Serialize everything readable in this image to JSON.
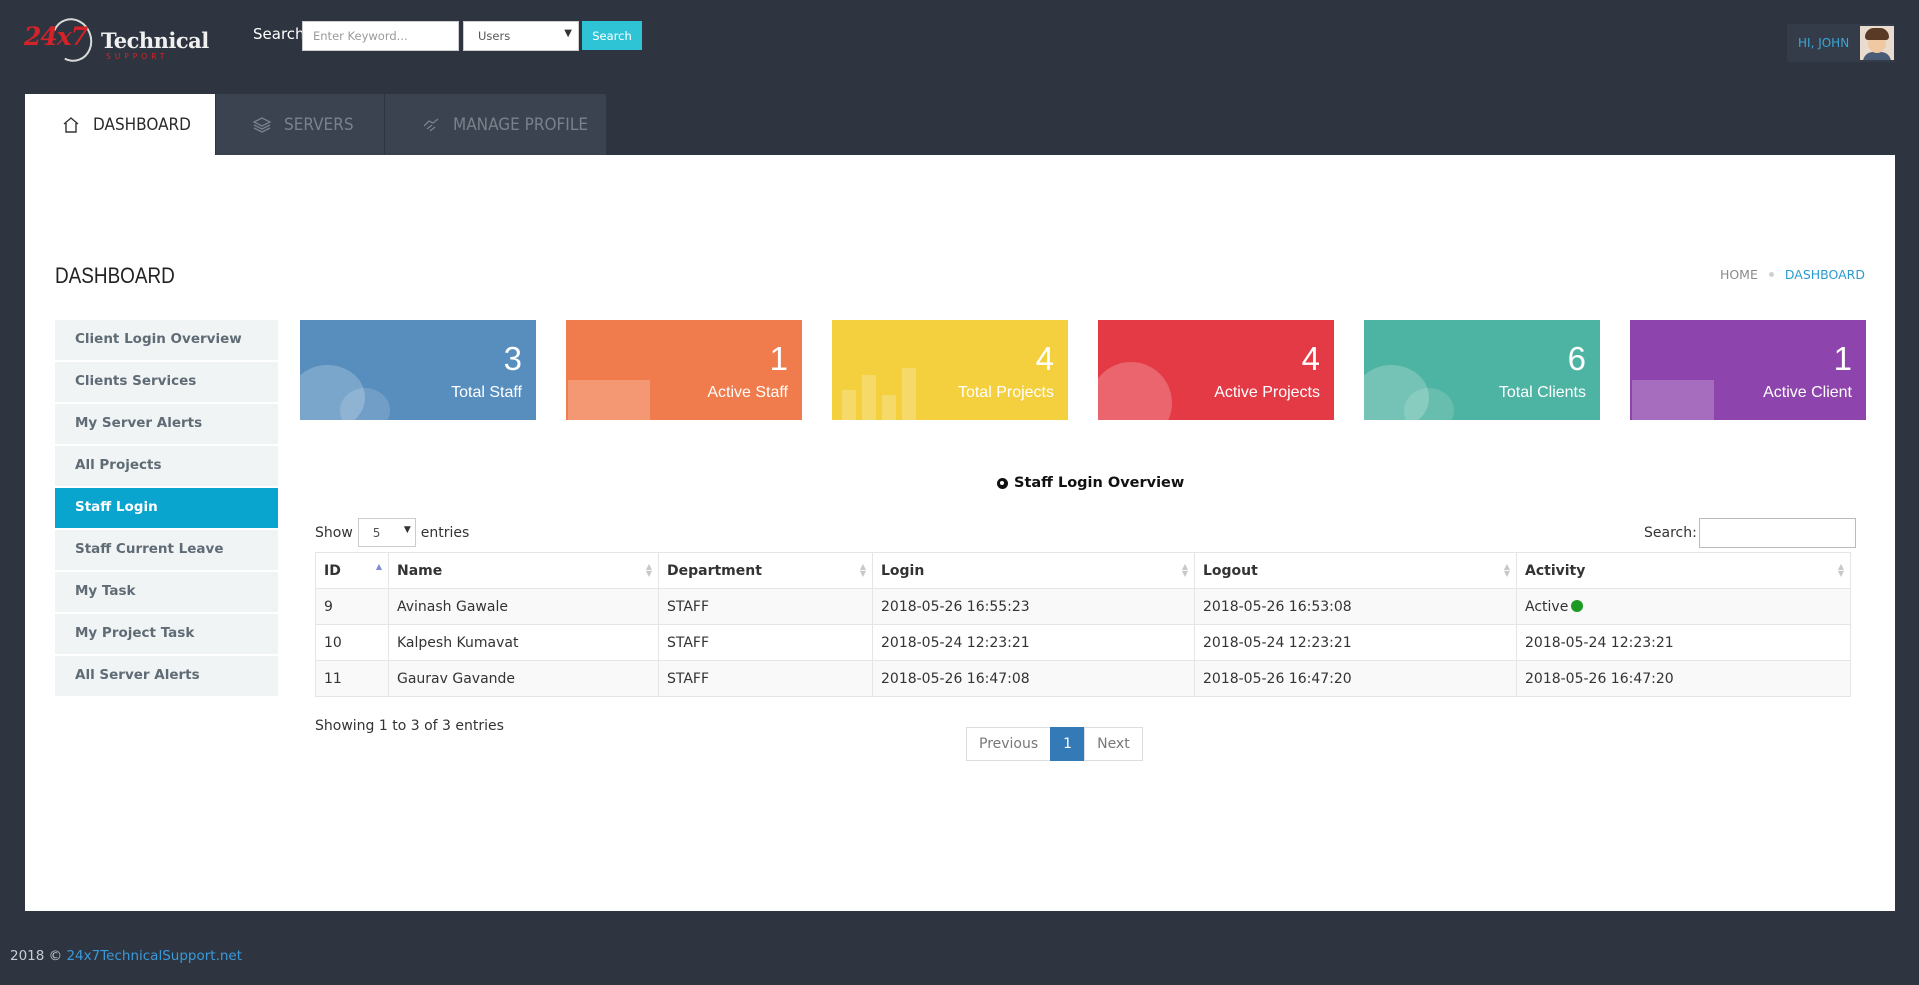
{
  "brand": {
    "logo_number": "24x7",
    "logo_name": "Technical",
    "logo_sub": "SUPPORT"
  },
  "header": {
    "search_label": "Search",
    "search_placeholder": "Enter Keyword...",
    "search_category": "Users",
    "search_button": "Search",
    "greeting": "HI, JOHN"
  },
  "tabs": [
    {
      "label": "DASHBOARD",
      "icon": "home-icon",
      "active": true
    },
    {
      "label": "SERVERS",
      "icon": "layers-icon",
      "active": false
    },
    {
      "label": "MANAGE PROFILE",
      "icon": "hand-icon",
      "active": false
    }
  ],
  "page": {
    "title": "DASHBOARD",
    "breadcrumb": [
      "HOME",
      "DASHBOARD"
    ]
  },
  "sidebar": {
    "items": [
      {
        "label": "Client Login Overview",
        "active": false
      },
      {
        "label": "Clients Services",
        "active": false
      },
      {
        "label": "My Server Alerts",
        "active": false
      },
      {
        "label": "All Projects",
        "active": false
      },
      {
        "label": "Staff Login",
        "active": true
      },
      {
        "label": "Staff Current Leave",
        "active": false
      },
      {
        "label": "My Task",
        "active": false
      },
      {
        "label": "My Project Task",
        "active": false
      },
      {
        "label": "All Server Alerts",
        "active": false
      }
    ]
  },
  "stats": [
    {
      "value": "3",
      "label": "Total Staff",
      "color": "#578ebe"
    },
    {
      "value": "1",
      "label": "Active Staff",
      "color": "#f07b4c"
    },
    {
      "value": "4",
      "label": "Total Projects",
      "color": "#f4d03f"
    },
    {
      "value": "4",
      "label": "Active Projects",
      "color": "#e43a45"
    },
    {
      "value": "6",
      "label": "Total Clients",
      "color": "#4db3a2"
    },
    {
      "value": "1",
      "label": "Active Client",
      "color": "#8e44ad"
    }
  ],
  "table": {
    "title": "Staff Login Overview",
    "show_label": "Show",
    "show_value": "5",
    "entries_label": "entries",
    "search_label": "Search:",
    "columns": [
      "ID",
      "Name",
      "Department",
      "Login",
      "Logout",
      "Activity"
    ],
    "rows": [
      {
        "id": "9",
        "name": "Avinash Gawale",
        "department": "STAFF",
        "login": "2018-05-26 16:55:23",
        "logout": "2018-05-26 16:53:08",
        "activity": "Active"
      },
      {
        "id": "10",
        "name": "Kalpesh Kumavat",
        "department": "STAFF",
        "login": "2018-05-24 12:23:21",
        "logout": "2018-05-24 12:23:21",
        "activity": "2018-05-24 12:23:21"
      },
      {
        "id": "11",
        "name": "Gaurav Gavande",
        "department": "STAFF",
        "login": "2018-05-26 16:47:08",
        "logout": "2018-05-26 16:47:20",
        "activity": "2018-05-26 16:47:20"
      }
    ],
    "info": "Showing 1 to 3 of 3 entries",
    "pagination": {
      "previous": "Previous",
      "current": "1",
      "next": "Next"
    }
  },
  "footer": {
    "prefix": "2018 ©",
    "link": "24x7TechnicalSupport.net"
  },
  "colors": {
    "background": "#2e3540",
    "accent": "#0aa5cf",
    "active_dot": "#1d9a21"
  }
}
